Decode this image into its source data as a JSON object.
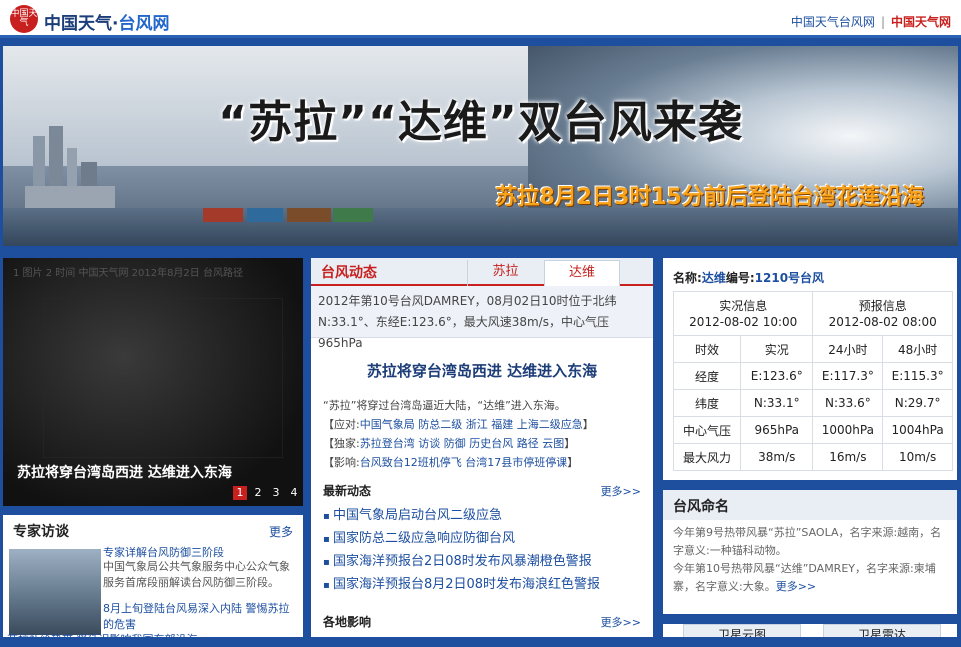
{
  "header": {
    "logo_seal": "中国天气",
    "logo_main": "中国天气·",
    "logo_sub": "台风网",
    "link_typhoon": "中国天气台风网",
    "separator": "|",
    "link_weather": "中国天气网"
  },
  "banner": {
    "title": "“苏拉”“达维”双台风来袭",
    "subtitle": "苏拉8月2日3时15分前后登陆台湾花莲沿海"
  },
  "photo": {
    "caption": "苏拉将穿台湾岛西进 达维进入东海",
    "faint_text": "1 图片 2 时间 中国天气网 2012年8月2日 台风路径",
    "pages": [
      "1",
      "2",
      "3",
      "4"
    ],
    "active_page": "1"
  },
  "expert": {
    "title": "专家访谈",
    "more": "更多",
    "item1": "专家详解台风防御三阶段",
    "item2": "中国气象局公共气象服务中心公众气象服务首席段丽解读台风防御三阶段。",
    "item3": "8月上旬登陆台风易深入内陆 警惕苏拉的危害",
    "item4": "苏拉补给热带 将延迟影响我国东部沿海"
  },
  "typhoon_panel": {
    "tab_main": "台风动态",
    "tab_sula": "苏拉",
    "tab_damrey": "达维",
    "status_line1": "2012年第10号台风DAMREY，08月02日10时位于北纬",
    "status_line2": "N:33.1°、东经E:123.6°，最大风速38m/s，中心气压965hPa",
    "headline": "苏拉将穿台湾岛西进 达维进入东海",
    "summary": "“苏拉”将穿过台湾岛逼近大陆，“达维”进入东海。",
    "response_label": "【应对:",
    "response_links": "中国气象局 防总二级 浙江 福建 上海二级应急",
    "exclusive_label": "【独家:",
    "exclusive_links": "苏拉登台湾 访谈 防御 历史台风 路径 云图",
    "impact_label": "【影响:",
    "impact_links": "台风致台12班机停飞 台湾17县市停班停课",
    "close_bracket": "】",
    "latest_title": "最新动态",
    "latest_more": "更多>>",
    "latest_items": [
      "中国气象局启动台风二级应急",
      "国家防总二级应急响应防御台风",
      "国家海洋预报台2日08时发布风暴潮橙色警报",
      "国家海洋预报台8月2日08时发布海浪红色警报"
    ],
    "local_title": "各地影响",
    "local_more": "更多>>"
  },
  "info_panel": {
    "name_label": "名称:",
    "name_value": "达维",
    "number_label": "编号:",
    "number_value": "1210号台风",
    "obs_header": "实况信息",
    "obs_time": "2012-08-02 10:00",
    "fcst_header": "预报信息",
    "fcst_time": "2012-08-02 08:00",
    "col_headers": [
      "时效",
      "实况",
      "24小时",
      "48小时"
    ],
    "rows": [
      [
        "经度",
        "E:123.6°",
        "E:117.3°",
        "E:115.3°"
      ],
      [
        "纬度",
        "N:33.1°",
        "N:33.6°",
        "N:29.7°"
      ],
      [
        "中心气压",
        "965hPa",
        "1000hPa",
        "1004hPa"
      ],
      [
        "最大风力",
        "38m/s",
        "16m/s",
        "10m/s"
      ]
    ]
  },
  "naming": {
    "title": "台风命名",
    "text1": "今年第9号热带风暴“苏拉”SAOLA，名字来源:越南，名字意义:一种锚科动物。",
    "text2": "今年第10号热带风暴“达维”DAMREY，名字来源:柬埔寨，名字意义:大象。",
    "more": "更多>>"
  },
  "bottom_tabs": {
    "tab1": "卫星云图",
    "tab2": "卫星雷达"
  }
}
